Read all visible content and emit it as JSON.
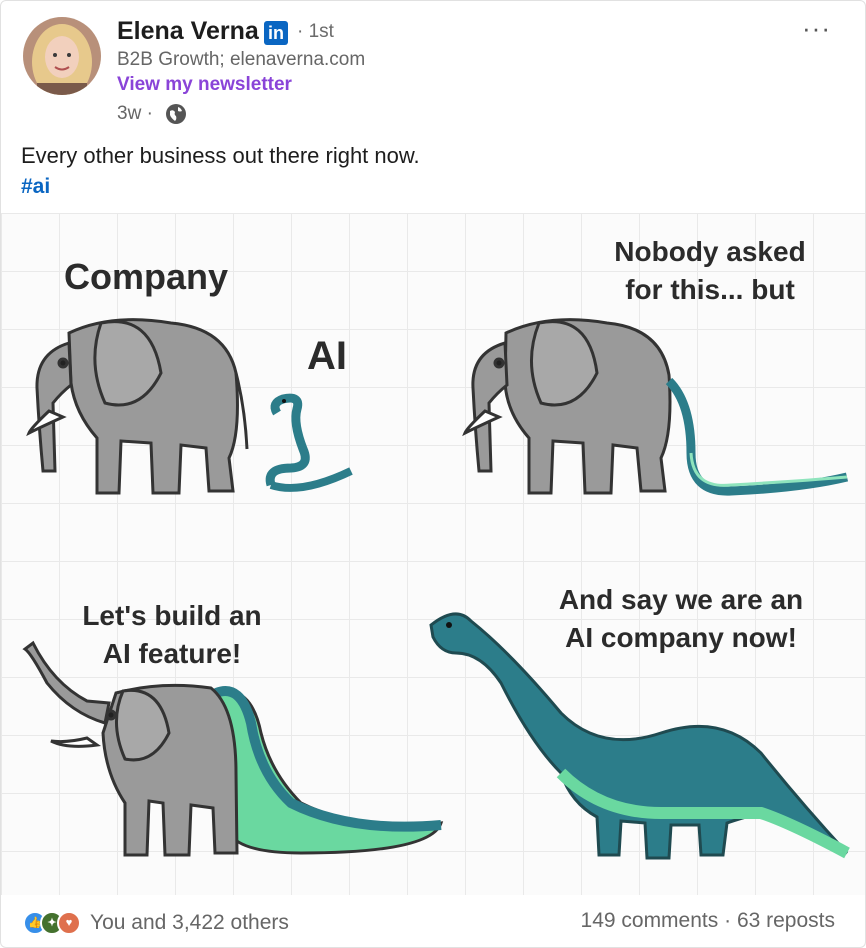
{
  "author": {
    "name": "Elena Verna",
    "badge": "in",
    "degree": "· 1st",
    "headline": "B2B Growth; elenaverna.com",
    "newsletter_link": "View my newsletter",
    "time_ago": "3w ·",
    "visibility_icon": "globe-icon"
  },
  "post": {
    "text": "Every other business out there right now.",
    "hashtag": "#ai"
  },
  "meme": {
    "label_company": "Company",
    "label_ai": "AI",
    "label_nobody_1": "Nobody asked",
    "label_nobody_2": "for this... but",
    "label_build_1": "Let's build an",
    "label_build_2": "AI feature!",
    "label_say_1": "And say we are an",
    "label_say_2": "AI company now!"
  },
  "social": {
    "reaction_icons": [
      "like-icon",
      "celebrate-icon",
      "love-icon"
    ],
    "reactions_text": "You and 3,422 others",
    "comments": "149 comments",
    "separator": "·",
    "reposts": "63 reposts"
  },
  "colors": {
    "linkedin_blue": "#0a66c2",
    "newsletter_purple": "#8a44d8",
    "elephant_gray": "#999999",
    "snake_teal": "#2c7d8a",
    "dino_green": "#6ad8a0"
  }
}
